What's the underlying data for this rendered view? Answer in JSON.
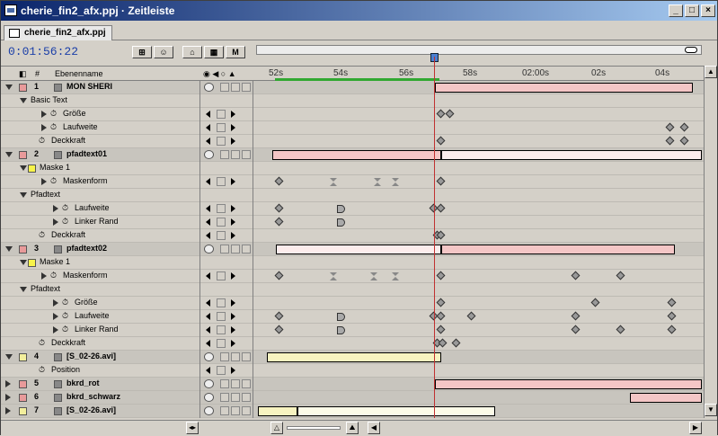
{
  "window": {
    "title": "cherie_fin2_afx.ppj · Zeitleiste"
  },
  "tab": {
    "label": "cherie_fin2_afx.ppj"
  },
  "timecode": "0:01:56:22",
  "header": {
    "hash": "#",
    "layer_name": "Ebenenname"
  },
  "ticks": [
    "52s",
    "54s",
    "56s",
    "58s",
    "02:00s",
    "02s",
    "04s"
  ],
  "rows": [
    {
      "type": "layer",
      "num": "1",
      "name": "MON SHERI",
      "color": "#e89a9a",
      "expanded": true
    },
    {
      "type": "prop",
      "name": "Basic Text",
      "indent": 1,
      "expanded": true
    },
    {
      "type": "prop",
      "name": "Größe",
      "indent": 3,
      "sw": true
    },
    {
      "type": "prop",
      "name": "Laufweite",
      "indent": 3,
      "sw": true
    },
    {
      "type": "prop",
      "name": "Deckkraft",
      "indent": 2,
      "sw": true
    },
    {
      "type": "layer",
      "num": "2",
      "name": "pfadtext01",
      "color": "#e89a9a",
      "expanded": true
    },
    {
      "type": "prop",
      "name": "Maske 1",
      "indent": 1,
      "mask": true,
      "expanded": true
    },
    {
      "type": "prop",
      "name": "Maskenform",
      "indent": 3,
      "sw": true
    },
    {
      "type": "prop",
      "name": "Pfadtext",
      "indent": 1,
      "expanded": true
    },
    {
      "type": "prop",
      "name": "Laufweite",
      "indent": 4,
      "sw": true
    },
    {
      "type": "prop",
      "name": "Linker Rand",
      "indent": 4,
      "sw": true
    },
    {
      "type": "prop",
      "name": "Deckkraft",
      "indent": 2,
      "sw": true
    },
    {
      "type": "layer",
      "num": "3",
      "name": "pfadtext02",
      "color": "#e89a9a",
      "expanded": true
    },
    {
      "type": "prop",
      "name": "Maske 1",
      "indent": 1,
      "mask": true,
      "expanded": true
    },
    {
      "type": "prop",
      "name": "Maskenform",
      "indent": 3,
      "sw": true
    },
    {
      "type": "prop",
      "name": "Pfadtext",
      "indent": 1,
      "expanded": true
    },
    {
      "type": "prop",
      "name": "Größe",
      "indent": 4,
      "sw": true
    },
    {
      "type": "prop",
      "name": "Laufweite",
      "indent": 4,
      "sw": true
    },
    {
      "type": "prop",
      "name": "Linker Rand",
      "indent": 4,
      "sw": true
    },
    {
      "type": "prop",
      "name": "Deckkraft",
      "indent": 2,
      "sw": true
    },
    {
      "type": "layer",
      "num": "4",
      "name": "[S_02-26.avi]",
      "color": "#f2ee9c",
      "expanded": true
    },
    {
      "type": "prop",
      "name": "Position",
      "indent": 2,
      "sw": true
    },
    {
      "type": "layer",
      "num": "5",
      "name": "bkrd_rot",
      "color": "#e89a9a",
      "expanded": false
    },
    {
      "type": "layer",
      "num": "6",
      "name": "bkrd_schwarz",
      "color": "#e89a9a",
      "expanded": false
    },
    {
      "type": "layer",
      "num": "7",
      "name": "[S_02-26.avi]",
      "color": "#f2ee9c",
      "expanded": false
    }
  ]
}
